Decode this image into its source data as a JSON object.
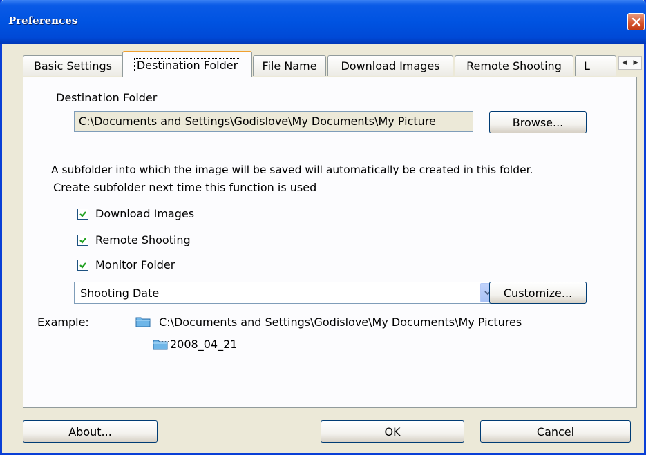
{
  "window": {
    "title": "Preferences"
  },
  "tabs": [
    {
      "label": "Basic Settings"
    },
    {
      "label": "Destination Folder"
    },
    {
      "label": "File Name"
    },
    {
      "label": "Download Images"
    },
    {
      "label": "Remote Shooting"
    },
    {
      "label": "L"
    }
  ],
  "destination": {
    "label": "Destination Folder",
    "path": "C:\\Documents and Settings\\Godislove\\My Documents\\My Picture",
    "browse_label": "Browse..."
  },
  "subfolder": {
    "description": "A subfolder into which the image will be saved will automatically be created in this folder.",
    "create_label": "Create subfolder next time this function is used",
    "options": [
      {
        "label": "Download Images",
        "checked": true
      },
      {
        "label": "Remote Shooting",
        "checked": true
      },
      {
        "label": "Monitor Folder",
        "checked": true
      }
    ],
    "format_selected": "Shooting Date",
    "customize_label": "Customize..."
  },
  "example": {
    "label": "Example:",
    "root_path": "C:\\Documents and Settings\\Godislove\\My Documents\\My Pictures",
    "subfolder_name": "2008_04_21"
  },
  "footer": {
    "about_label": "About...",
    "ok_label": "OK",
    "cancel_label": "Cancel"
  },
  "icons": {
    "close": "close-icon",
    "folder": "folder-icon",
    "dropdown": "chevron-down-icon",
    "checkbox": "check-icon"
  },
  "colors": {
    "titlebar": "#0053e1",
    "dialog_bg": "#ece9d8",
    "close_button": "#d5532c",
    "active_tab_highlight": "#f0a030",
    "checkmark": "#21a121"
  }
}
